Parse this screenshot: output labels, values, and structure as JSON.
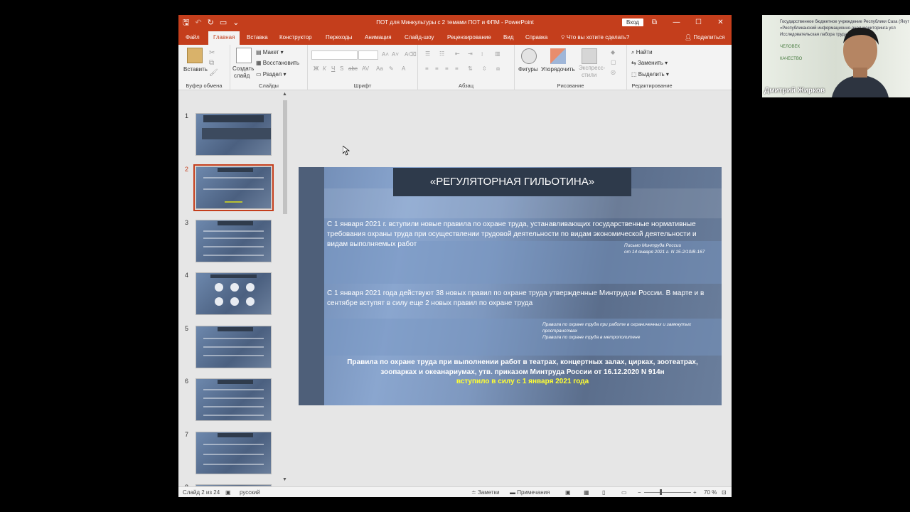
{
  "window": {
    "title": "ПОТ для Минкультуры с 2 темами ПОТ и ФПМ  -  PowerPoint",
    "signin": "Вход",
    "minimize": "—",
    "restore": "☐",
    "close": "✕"
  },
  "tabs": [
    {
      "label": "Файл"
    },
    {
      "label": "Главная"
    },
    {
      "label": "Вставка"
    },
    {
      "label": "Конструктор"
    },
    {
      "label": "Переходы"
    },
    {
      "label": "Анимация"
    },
    {
      "label": "Слайд-шоу"
    },
    {
      "label": "Рецензирование"
    },
    {
      "label": "Вид"
    },
    {
      "label": "Справка"
    }
  ],
  "tell_me": "Что вы хотите сделать?",
  "share": "Поделиться",
  "ribbon": {
    "clipboard": {
      "label": "Буфер обмена",
      "paste": "Вставить"
    },
    "slides": {
      "label": "Слайды",
      "new_slide_1": "Создать",
      "new_slide_2": "слайд",
      "layout": "Макет",
      "reset": "Восстановить",
      "section": "Раздел"
    },
    "font": {
      "label": "Шрифт"
    },
    "paragraph": {
      "label": "Абзац"
    },
    "drawing": {
      "label": "Рисование",
      "shapes": "Фигуры",
      "arrange": "Упорядочить",
      "styles_1": "Экспресс-",
      "styles_2": "стили"
    },
    "editing": {
      "label": "Редактирование",
      "find": "Найти",
      "replace": "Заменить",
      "select": "Выделить"
    }
  },
  "thumbnails": [
    {
      "num": "1"
    },
    {
      "num": "2"
    },
    {
      "num": "3"
    },
    {
      "num": "4"
    },
    {
      "num": "5"
    },
    {
      "num": "6"
    },
    {
      "num": "7"
    },
    {
      "num": "8"
    }
  ],
  "slide": {
    "title": "«РЕГУЛЯТОРНАЯ ГИЛЬОТИНА»",
    "para1": "С 1 января 2021 г. вступили новые правила по охране труда, устанавливающих государственные нормативные требования охраны труда при осуществлении трудовой деятельности по видам экономической деятельности и видам выполняемых работ",
    "ref1_line1": "Письмо Минтруда России",
    "ref1_line2": "от 14 января 2021 г. N 15-2/10/В-167",
    "para2": "С 1 января 2021 года действуют 38 новых правил по охране труда утвержденные Минтрудом России. В марте и в сентябре вступят в силу еще 2 новых правил по охране труда",
    "ref2_line1": "Правила по охране труда при работе в ограниченных и замкнутых пространствах",
    "ref2_line2": "Правила по охране труда в метрополитене",
    "para3": "Правила по охране труда при выполнении работ в театрах, концертных залах, цирках, зоотеатрах, зоопарках и океанариумах, утв. приказом Минтруда России от 16.12.2020 N 914н",
    "para4": "вступило в силу с 1 января 2021 года"
  },
  "status": {
    "slide_of": "Слайд 2 из 24",
    "language": "русский",
    "notes": "Заметки",
    "comments": "Примечания",
    "zoom": "70 %"
  },
  "webcam": {
    "name": "Дмитрий Жирков",
    "wall_line1": "Государственное бюджетное учреждение Республики Саха (Якут",
    "wall_line2": "«Республиканский информационно-анал        мониторинга усл",
    "wall_line3": "Исследовательская лабора          труда",
    "wall_line4": "ЧЕЛОВЕК",
    "wall_line5": "КАЧЕСТВО"
  },
  "colors": {
    "accent": "#c43e1c",
    "slide_title_bg": "#2e3a4b",
    "highlight_text": "#ffff33"
  }
}
